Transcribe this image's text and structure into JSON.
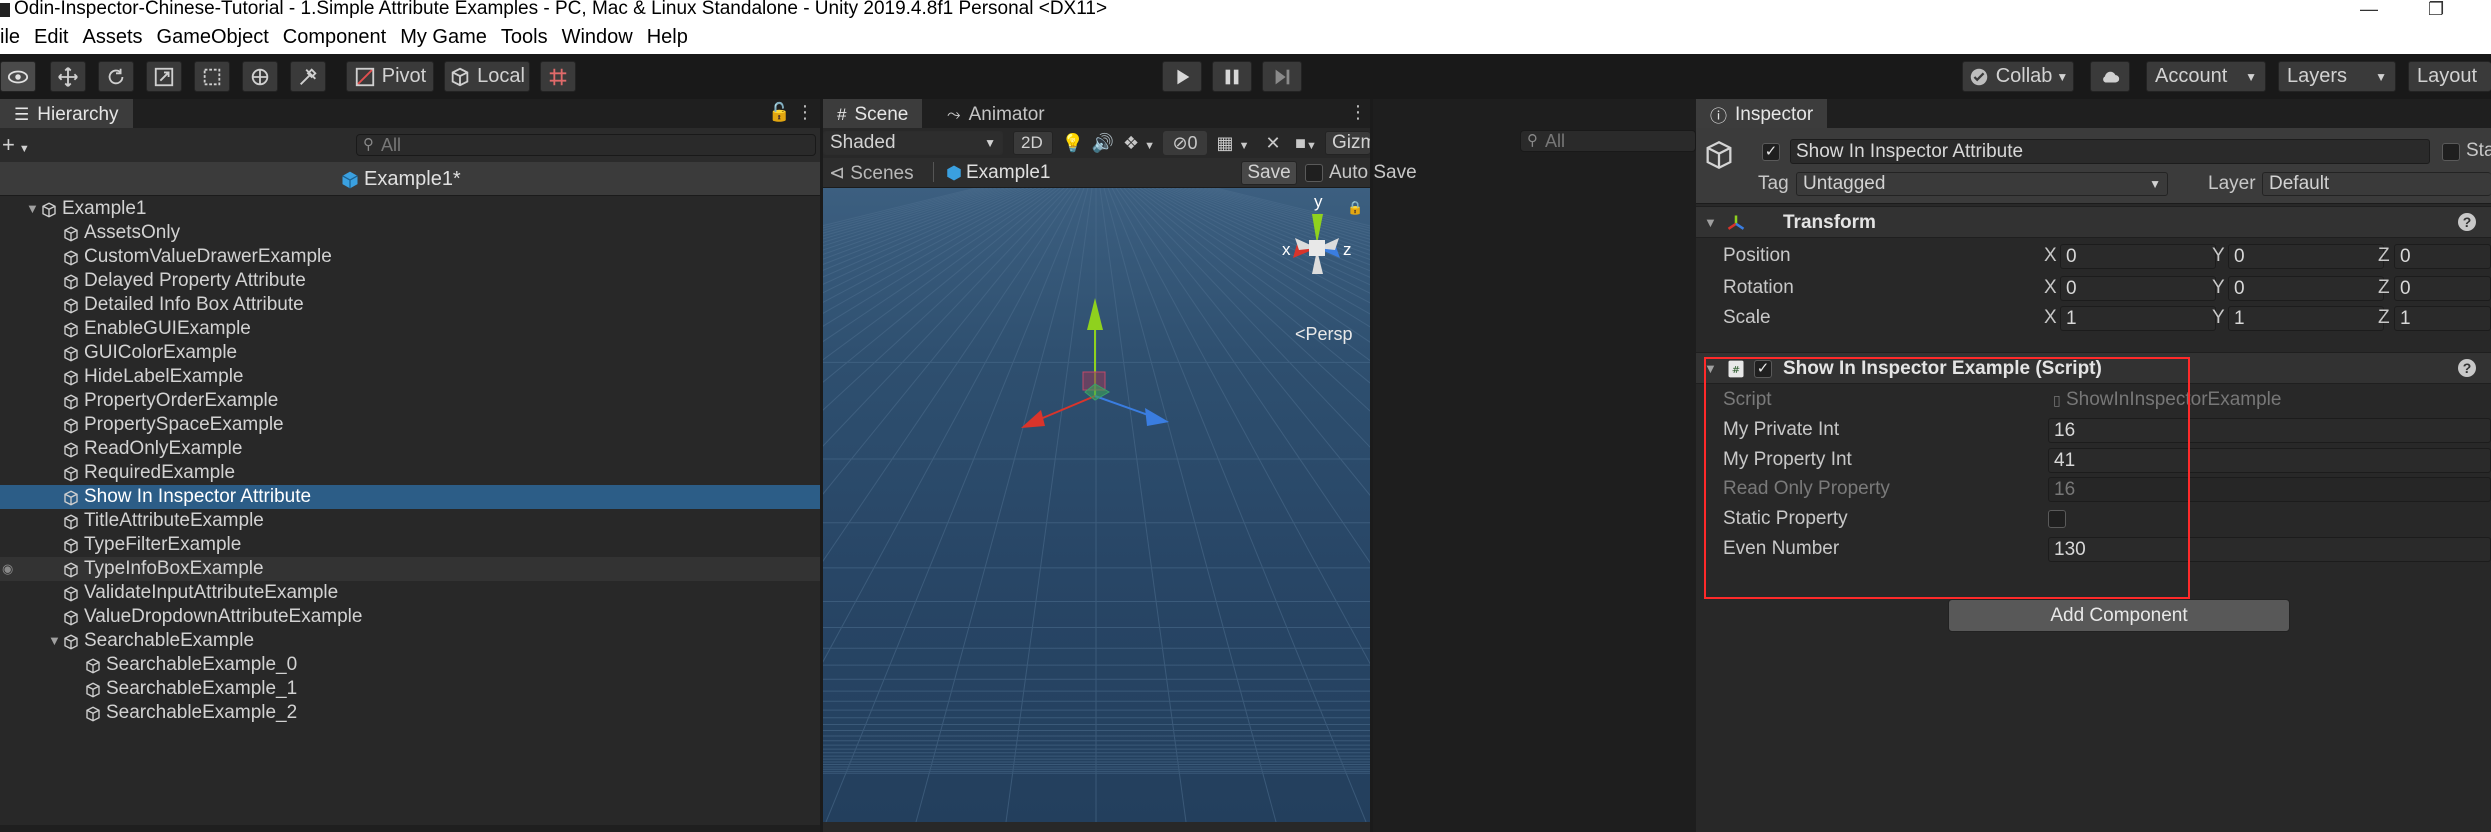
{
  "window": {
    "title": "Odin-Inspector-Chinese-Tutorial - 1.Simple Attribute Examples - PC, Mac & Linux Standalone - Unity 2019.4.8f1 Personal <DX11>",
    "minimize_glyph": "—",
    "restore_glyph": "❐"
  },
  "menu": [
    "ile",
    "Edit",
    "Assets",
    "GameObject",
    "Component",
    "My Game",
    "Tools",
    "Window",
    "Help"
  ],
  "toolbar": {
    "pivot_label": "Pivot",
    "local_label": "Local",
    "collab_label": "Collab",
    "account_label": "Account",
    "layers_label": "Layers",
    "layout_label": "Layout",
    "icons": [
      "view-tool-icon",
      "move-tool-icon",
      "rotate-tool-icon",
      "scale-tool-icon",
      "rect-tool-icon",
      "transform-tool-icon",
      "custom-tool-icon"
    ]
  },
  "hierarchy": {
    "tab_label": "Hierarchy",
    "add_glyph": "+",
    "search_placeholder": "All",
    "scene_name": "Example1*",
    "items": [
      {
        "name": "Example1",
        "depth": 0,
        "expanded": true
      },
      {
        "name": "AssetsOnly",
        "depth": 1
      },
      {
        "name": "CustomValueDrawerExample",
        "depth": 1
      },
      {
        "name": "Delayed Property Attribute",
        "depth": 1
      },
      {
        "name": "Detailed Info Box Attribute",
        "depth": 1
      },
      {
        "name": "EnableGUIExample",
        "depth": 1
      },
      {
        "name": "GUIColorExample",
        "depth": 1
      },
      {
        "name": "HideLabelExample",
        "depth": 1
      },
      {
        "name": "PropertyOrderExample",
        "depth": 1
      },
      {
        "name": "PropertySpaceExample",
        "depth": 1
      },
      {
        "name": "ReadOnlyExample",
        "depth": 1
      },
      {
        "name": "RequiredExample",
        "depth": 1
      },
      {
        "name": "Show In Inspector Attribute",
        "depth": 1,
        "selected": true
      },
      {
        "name": "TitleAttributeExample",
        "depth": 1
      },
      {
        "name": "TypeFilterExample",
        "depth": 1
      },
      {
        "name": "TypeInfoBoxExample",
        "depth": 1,
        "hover": true
      },
      {
        "name": "ValidateInputAttributeExample",
        "depth": 1
      },
      {
        "name": "ValueDropdownAttributeExample",
        "depth": 1
      },
      {
        "name": "SearchableExample",
        "depth": 1,
        "expanded": true
      },
      {
        "name": "SearchableExample_0",
        "depth": 2
      },
      {
        "name": "SearchableExample_1",
        "depth": 2
      },
      {
        "name": "SearchableExample_2",
        "depth": 2
      }
    ]
  },
  "scene": {
    "tab_scene": "Scene",
    "tab_animator": "Animator",
    "shading_mode": "Shaded",
    "mode_2d": "2D",
    "hidden_count": "0",
    "gizmos_label": "Gizmos",
    "search_placeholder": "All",
    "breadcrumb_scenes": "Scenes",
    "breadcrumb_scene": "Example1",
    "save_label": "Save",
    "auto_save_label": "Auto Save",
    "persp_label": "Persp",
    "axis_y": "y",
    "axis_x": "x",
    "axis_z": "z"
  },
  "inspector": {
    "tab_label": "Inspector",
    "object_name": "Show In Inspector Attribute",
    "static_label": "Sta",
    "tag_label": "Tag",
    "tag_value": "Untagged",
    "layer_label": "Layer",
    "layer_value": "Default",
    "transform": {
      "title": "Transform",
      "position_label": "Position",
      "rotation_label": "Rotation",
      "scale_label": "Scale",
      "position": {
        "x": "0",
        "y": "0",
        "z": "0"
      },
      "rotation": {
        "x": "0",
        "y": "0",
        "z": "0"
      },
      "scale": {
        "x": "1",
        "y": "1",
        "z": "1"
      },
      "axis_x": "X",
      "axis_y": "Y",
      "axis_z": "Z"
    },
    "script_component": {
      "title": "Show In Inspector Example (Script)",
      "script_label": "Script",
      "script_value": "ShowInInspectorExample",
      "fields": [
        {
          "label": "My Private Int",
          "value": "16"
        },
        {
          "label": "My Property Int",
          "value": "41"
        },
        {
          "label": "Read Only Property",
          "value": "16"
        },
        {
          "label": "Static Property",
          "value": ""
        },
        {
          "label": "Even Number",
          "value": "130"
        }
      ]
    },
    "help_glyph": "?",
    "add_component_label": "Add Component"
  },
  "colors": {
    "accent_selected": "#2c5d87",
    "highlight_outline": "#ff2a2a",
    "axis_x": "#d9342b",
    "axis_y": "#8fd11e",
    "axis_z": "#3a7de0"
  }
}
